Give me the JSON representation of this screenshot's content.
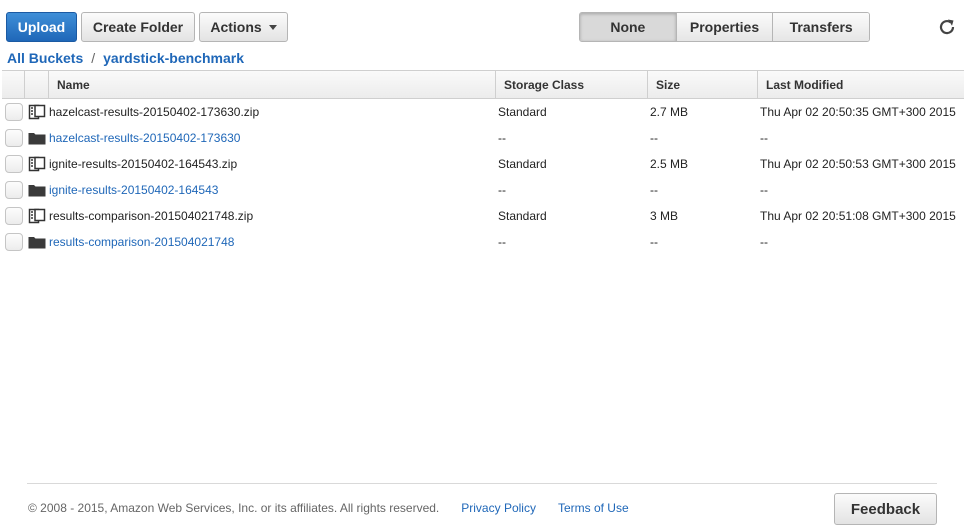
{
  "toolbar": {
    "upload_label": "Upload",
    "create_folder_label": "Create Folder",
    "actions_label": "Actions",
    "view_options": [
      "None",
      "Properties",
      "Transfers"
    ],
    "active_view": "None"
  },
  "breadcrumb": {
    "root": "All Buckets",
    "separator": "/",
    "bucket": "yardstick-benchmark"
  },
  "table": {
    "columns": [
      "Name",
      "Storage Class",
      "Size",
      "Last Modified"
    ],
    "rows": [
      {
        "icon": "zip-file-icon",
        "name": "hazelcast-results-20150402-173630.zip",
        "storage_class": "Standard",
        "size": "2.7 MB",
        "last_modified": "Thu Apr 02 20:50:35 GMT+300 2015",
        "is_folder": false
      },
      {
        "icon": "folder-icon",
        "name": "hazelcast-results-20150402-173630",
        "storage_class": "--",
        "size": "--",
        "last_modified": "--",
        "is_folder": true
      },
      {
        "icon": "zip-file-icon",
        "name": "ignite-results-20150402-164543.zip",
        "storage_class": "Standard",
        "size": "2.5 MB",
        "last_modified": "Thu Apr 02 20:50:53 GMT+300 2015",
        "is_folder": false
      },
      {
        "icon": "folder-icon",
        "name": "ignite-results-20150402-164543",
        "storage_class": "--",
        "size": "--",
        "last_modified": "--",
        "is_folder": true
      },
      {
        "icon": "zip-file-icon",
        "name": "results-comparison-201504021748.zip",
        "storage_class": "Standard",
        "size": "3 MB",
        "last_modified": "Thu Apr 02 20:51:08 GMT+300 2015",
        "is_folder": false
      },
      {
        "icon": "folder-icon",
        "name": "results-comparison-201504021748",
        "storage_class": "--",
        "size": "--",
        "last_modified": "--",
        "is_folder": true
      }
    ]
  },
  "footer": {
    "copyright": "© 2008 - 2015, Amazon Web Services, Inc. or its affiliates. All rights reserved.",
    "privacy_label": "Privacy Policy",
    "terms_label": "Terms of Use",
    "feedback_label": "Feedback"
  },
  "colors": {
    "accent": "#1f67b8",
    "primary_button": "#2a77c8"
  }
}
